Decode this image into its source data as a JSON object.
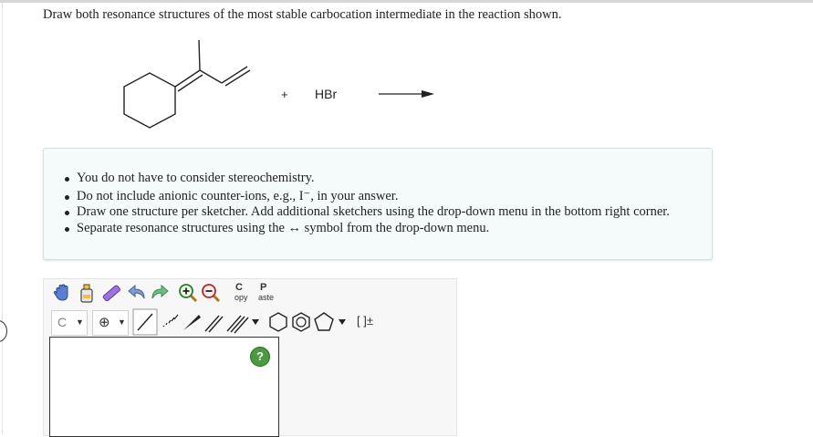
{
  "question": {
    "text": "Draw both resonance structures of the most stable carbocation intermediate in the reaction shown."
  },
  "reaction": {
    "plus": "+",
    "reagent": "HBr",
    "arrow": "reaction-arrow"
  },
  "instructions": {
    "items": [
      "You do not have to consider stereochemistry.",
      "Do not include anionic counter-ions, e.g., I⁻, in your answer.",
      "Draw one structure per sketcher. Add additional sketchers using the drop-down menu in the bottom right corner.",
      "Separate resonance structures using the ↔ symbol from the drop-down menu."
    ]
  },
  "sketcher": {
    "copy_label_top": "C",
    "copy_label_bottom": "opy",
    "paste_label_top": "P",
    "paste_label_bottom": "aste",
    "atom_label": "C",
    "charge_symbol": "⊕",
    "bracket_label": "[ ]±",
    "help_label": "?"
  },
  "icons": {
    "hand": "hand-icon",
    "erase_bottle": "eraser-bottle-icon",
    "eraser": "eraser-icon",
    "undo": "undo-icon",
    "redo": "redo-icon",
    "zoom_in": "zoom-in-icon",
    "zoom_out": "zoom-out-icon"
  },
  "colors": {
    "info_bg": "#f5fafa",
    "help_green": "#4a9a3f",
    "eraser_purple": "#8a5fd6"
  }
}
